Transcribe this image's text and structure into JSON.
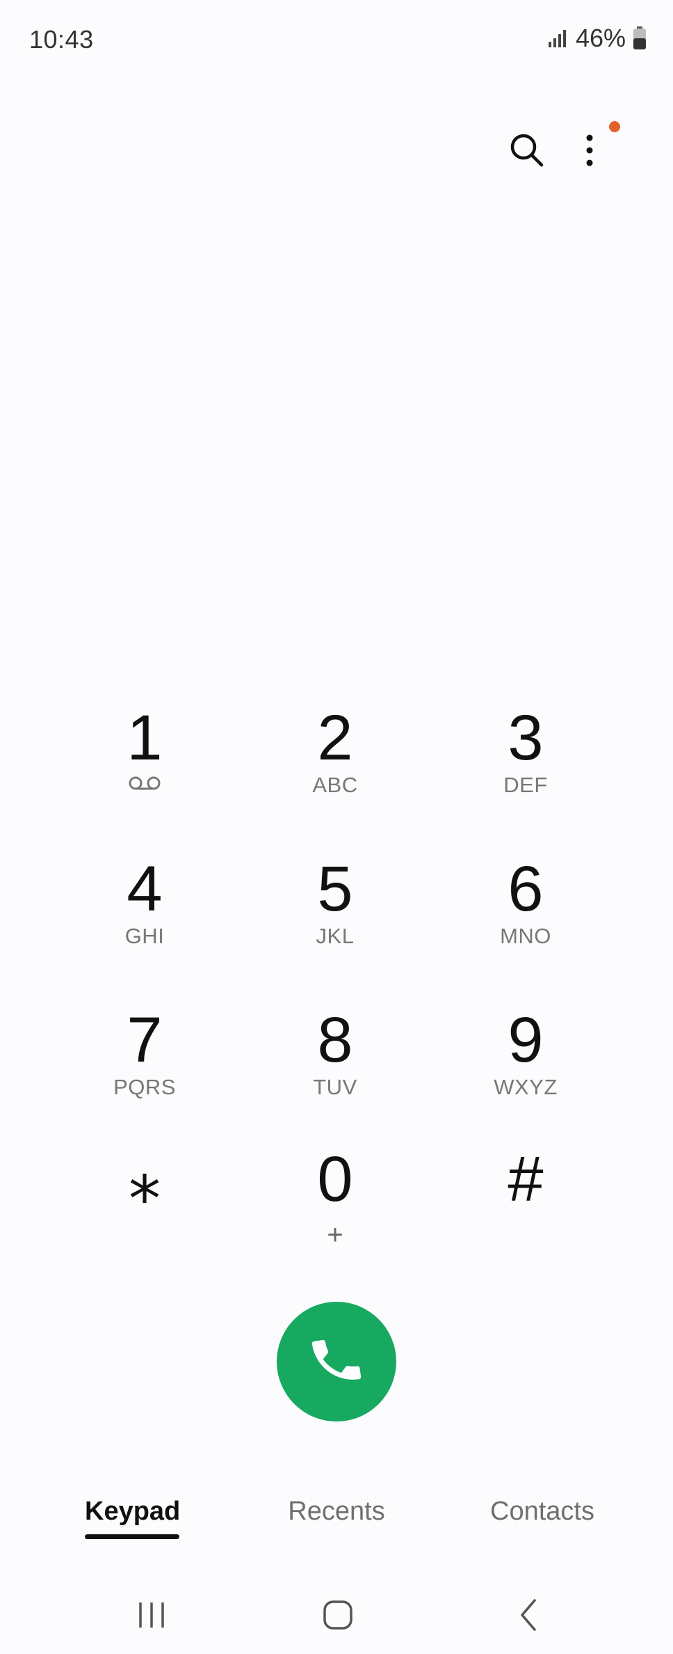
{
  "status_bar": {
    "time": "10:43",
    "battery_percent": "46%",
    "icons": [
      "signal-icon",
      "battery-icon"
    ]
  },
  "toolbar": {
    "icons": [
      "search-icon",
      "more-options-icon"
    ],
    "notification_dot_color": "#e2622b"
  },
  "keypad": {
    "keys": [
      {
        "digit": "1",
        "letters": "",
        "icon": "voicemail-icon"
      },
      {
        "digit": "2",
        "letters": "ABC"
      },
      {
        "digit": "3",
        "letters": "DEF"
      },
      {
        "digit": "4",
        "letters": "GHI"
      },
      {
        "digit": "5",
        "letters": "JKL"
      },
      {
        "digit": "6",
        "letters": "MNO"
      },
      {
        "digit": "7",
        "letters": "PQRS"
      },
      {
        "digit": "8",
        "letters": "TUV"
      },
      {
        "digit": "9",
        "letters": "WXYZ"
      },
      {
        "digit": "⁎",
        "letters": ""
      },
      {
        "digit": "0",
        "letters": "+"
      },
      {
        "digit": "#",
        "letters": ""
      }
    ]
  },
  "call_button": {
    "icon": "phone-icon",
    "color": "#16a95f"
  },
  "tabs": [
    {
      "label": "Keypad",
      "active": true
    },
    {
      "label": "Recents",
      "active": false
    },
    {
      "label": "Contacts",
      "active": false
    }
  ],
  "nav_bar": {
    "icons": [
      "recent-apps-icon",
      "home-icon",
      "back-icon"
    ]
  }
}
